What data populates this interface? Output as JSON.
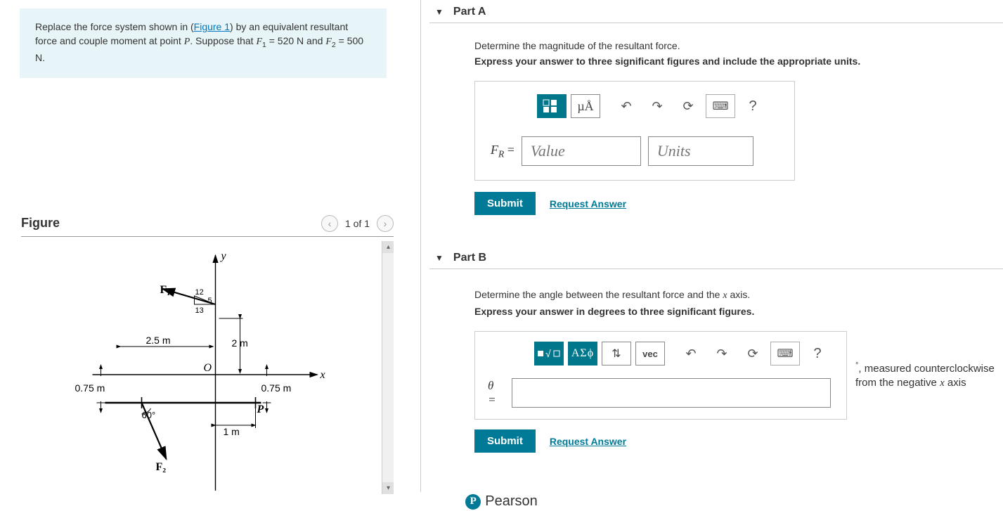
{
  "problem": {
    "text_a": "Replace the force system shown in (",
    "figure_link": "Figure 1",
    "text_b": ") by an equivalent resultant force and couple moment at point ",
    "point_label": "P",
    "text_c": ". Suppose that ",
    "F1_sym": "F",
    "F1_sub": "1",
    "F1_eq": " = 520 N",
    "and": " and ",
    "F2_sym": "F",
    "F2_sub": "2",
    "F2_eq": " = 500 N",
    "period": "."
  },
  "figure": {
    "title": "Figure",
    "pager": "1 of 1",
    "labels": {
      "y": "y",
      "x": "x",
      "F1": "F₁",
      "F2": "F₂",
      "tri_12": "12",
      "tri_5": "5",
      "tri_13": "13",
      "d_2_5m": "2.5 m",
      "h_2m": "2 m",
      "d_075m_a": "0.75 m",
      "d_075m_b": "0.75 m",
      "d_1m": "1 m",
      "angle60": "60°",
      "O": "O",
      "P": "P"
    }
  },
  "partA": {
    "title": "Part A",
    "instr1": "Determine the magnitude of the resultant force.",
    "instr2": "Express your answer to three significant figures and include the appropriate units.",
    "label_html_pre": "F",
    "label_sub": "R",
    "label_eq": " = ",
    "value_ph": "Value",
    "units_ph": "Units",
    "toolbar": {
      "templates": "□■",
      "units": "µÅ",
      "undo": "↶",
      "redo": "↷",
      "reset": "⟳",
      "keyboard": "⌨",
      "help": "?"
    },
    "submit": "Submit",
    "request": "Request Answer"
  },
  "partB": {
    "title": "Part B",
    "instr1_a": "Determine the angle between the resultant force and the ",
    "instr1_x": "x",
    "instr1_b": " axis.",
    "instr2": "Express your answer in degrees to three significant figures.",
    "label": "θ = ",
    "toolbar": {
      "templates": "■√□",
      "greek": "ΑΣϕ",
      "updown": "⇅",
      "vec": "vec",
      "undo": "↶",
      "redo": "↷",
      "reset": "⟳",
      "keyboard": "⌨",
      "help": "?"
    },
    "suffix_a": ", measured counterclockwise from the negative ",
    "suffix_x": "x",
    "suffix_b": " axis",
    "deg_sym": "°",
    "submit": "Submit",
    "request": "Request Answer"
  },
  "footer": {
    "brand": "Pearson",
    "icon": "P"
  }
}
